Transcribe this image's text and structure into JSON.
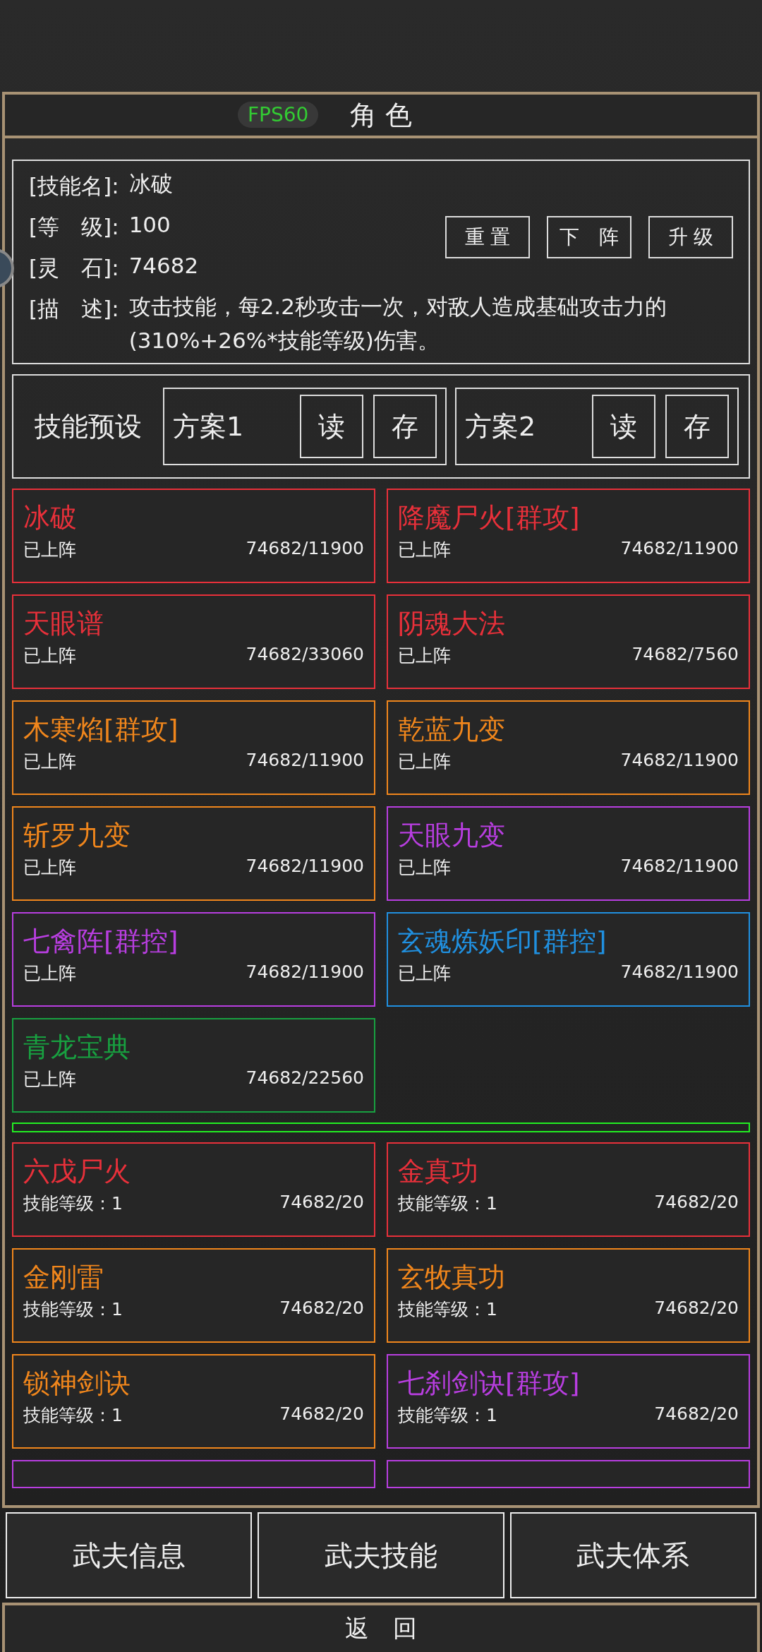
{
  "header": {
    "title": "角 色",
    "fps_badge": "FPS60"
  },
  "skill_info": {
    "rows": [
      {
        "label": "[技能名]:",
        "value": "冰破"
      },
      {
        "label": "[等　级]:",
        "value": "100"
      },
      {
        "label": "[灵　石]:",
        "value": "74682"
      },
      {
        "label": "[描　述]:",
        "value": "攻击技能，每2.2秒攻击一次，对敌人造成基础攻击力的(310%+26%*技能等级)伤害。"
      }
    ],
    "buttons": [
      "重 置",
      "下　阵",
      "升 级"
    ]
  },
  "preset": {
    "label": "技能预设",
    "schemes": [
      {
        "name": "方案1",
        "load": "读",
        "save": "存"
      },
      {
        "name": "方案2",
        "load": "读",
        "save": "存"
      }
    ]
  },
  "equipped_skills": [
    {
      "name": "冰破",
      "status": "已上阵",
      "cost": "74682/11900",
      "color": "#e8303a"
    },
    {
      "name": "降魔尸火[群攻]",
      "status": "已上阵",
      "cost": "74682/11900",
      "color": "#e8303a"
    },
    {
      "name": "天眼谱",
      "status": "已上阵",
      "cost": "74682/33060",
      "color": "#e8303a"
    },
    {
      "name": "阴魂大法",
      "status": "已上阵",
      "cost": "74682/7560",
      "color": "#e8303a"
    },
    {
      "name": "木寒焰[群攻]",
      "status": "已上阵",
      "cost": "74682/11900",
      "color": "#f0861c"
    },
    {
      "name": "乾蓝九变",
      "status": "已上阵",
      "cost": "74682/11900",
      "color": "#f0861c"
    },
    {
      "name": "斩罗九变",
      "status": "已上阵",
      "cost": "74682/11900",
      "color": "#f0861c"
    },
    {
      "name": "天眼九变",
      "status": "已上阵",
      "cost": "74682/11900",
      "color": "#b83ee0"
    },
    {
      "name": "七禽阵[群控]",
      "status": "已上阵",
      "cost": "74682/11900",
      "color": "#b83ee0"
    },
    {
      "name": "玄魂炼妖印[群控]",
      "status": "已上阵",
      "cost": "74682/11900",
      "color": "#2090e0"
    },
    {
      "name": "青龙宝典",
      "status": "已上阵",
      "cost": "74682/22560",
      "color": "#18a040"
    }
  ],
  "other_skills": [
    {
      "name": "六戊尸火",
      "status": "技能等级：1",
      "cost": "74682/20",
      "color": "#e8303a"
    },
    {
      "name": "金真功",
      "status": "技能等级：1",
      "cost": "74682/20",
      "color": "#e8303a"
    },
    {
      "name": "金刚雷",
      "status": "技能等级：1",
      "cost": "74682/20",
      "color": "#f0861c"
    },
    {
      "name": "玄牧真功",
      "status": "技能等级：1",
      "cost": "74682/20",
      "color": "#f0861c"
    },
    {
      "name": "锁神剑诀",
      "status": "技能等级：1",
      "cost": "74682/20",
      "color": "#f0861c"
    },
    {
      "name": "七刹剑诀[群攻]",
      "status": "技能等级：1",
      "cost": "74682/20",
      "color": "#b83ee0"
    },
    {
      "kind": "cut",
      "color": "#b83ee0"
    },
    {
      "kind": "cut",
      "color": "#b83ee0"
    }
  ],
  "tabs": [
    {
      "label": "武夫信息"
    },
    {
      "label": "武夫技能"
    },
    {
      "label": "武夫体系"
    }
  ],
  "back_button": "返　回"
}
